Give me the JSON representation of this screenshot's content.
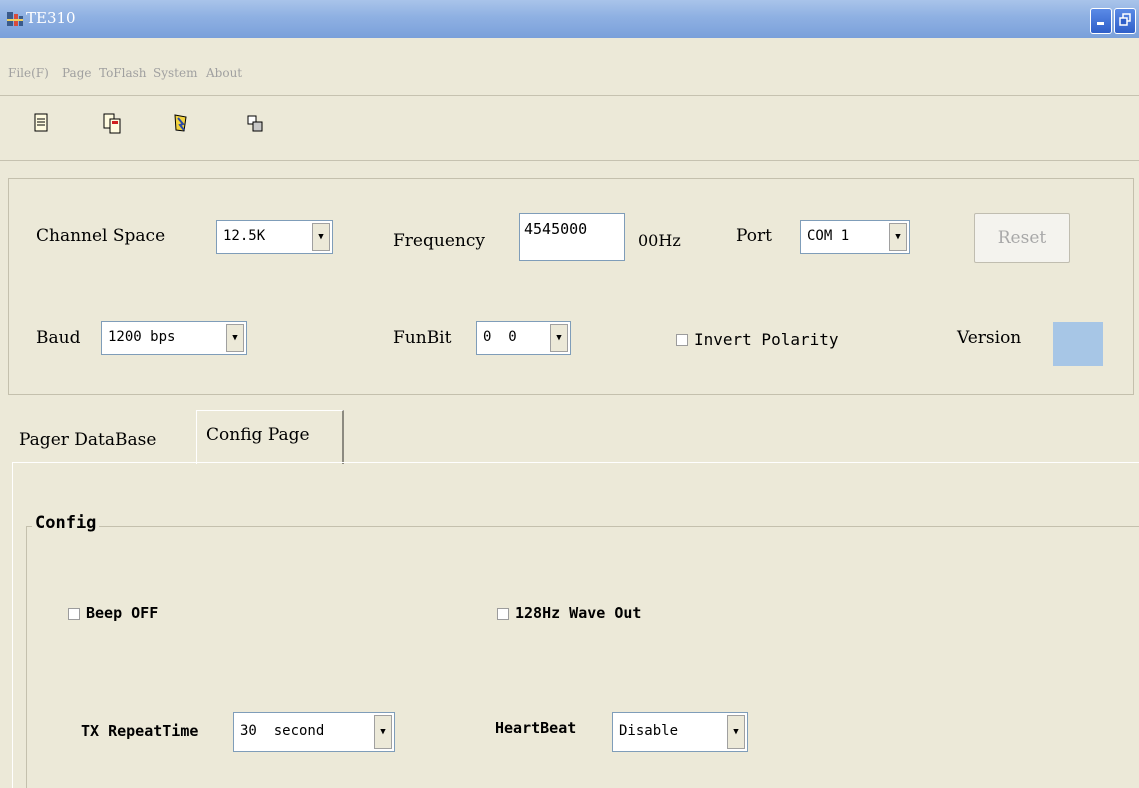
{
  "window": {
    "title": "TE310",
    "min_icon": "minimize-icon",
    "restore_icon": "restore-icon"
  },
  "menu": {
    "items": [
      {
        "label": "File(F)"
      },
      {
        "label": "Page"
      },
      {
        "label": "ToFlash"
      },
      {
        "label": "System"
      },
      {
        "label": "About"
      }
    ]
  },
  "toolbar": {
    "icons": [
      "new-page-icon",
      "copy-page-icon",
      "flash-icon",
      "windows-icon"
    ]
  },
  "settings": {
    "channel_space_label": "Channel Space",
    "channel_space_value": "12.5K",
    "frequency_label": "Frequency",
    "frequency_value": "4545000",
    "frequency_unit": "00Hz",
    "port_label": "Port",
    "port_value": "COM 1",
    "reset_label": "Reset",
    "baud_label": "Baud",
    "baud_value": "1200 bps",
    "funbit_label": "FunBit",
    "funbit_value": "0  0",
    "invert_label": "Invert Polarity",
    "invert_checked": false,
    "version_label": "Version",
    "version_color": "#a7c6e6"
  },
  "tabs": [
    {
      "label": "Pager DataBase",
      "active": false
    },
    {
      "label": "Config Page",
      "active": true
    }
  ],
  "config": {
    "legend": "Config",
    "beep_label": "Beep OFF",
    "beep_checked": false,
    "wave_label": "128Hz Wave Out",
    "wave_checked": false,
    "repeat_label": "TX RepeatTime",
    "repeat_value": "30  second",
    "heartbeat_label": "HeartBeat",
    "heartbeat_value": "Disable"
  }
}
